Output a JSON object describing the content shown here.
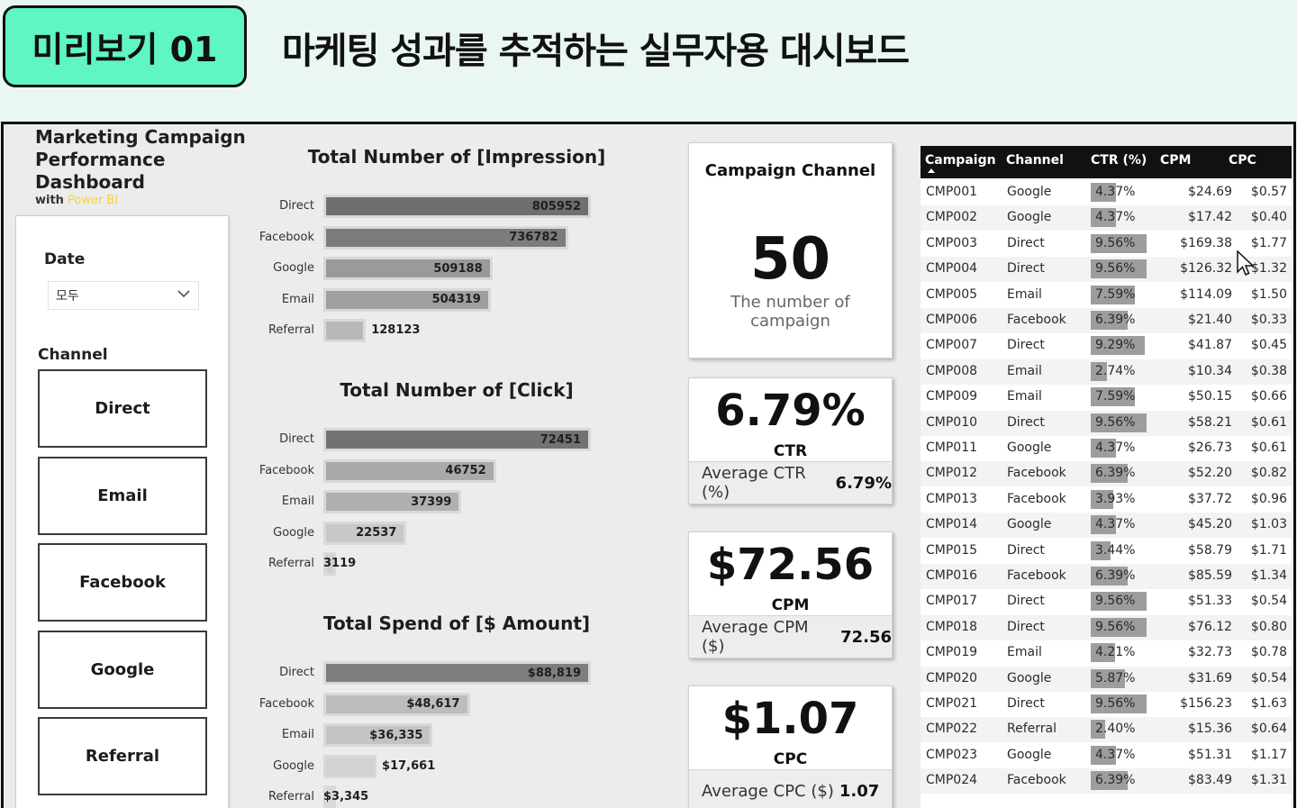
{
  "banner": {
    "badge": "미리보기 01",
    "title": "마케팅 성과를 추적하는 실무자용 대시보드"
  },
  "colors": {
    "badge_bg": "#5ff5c4",
    "powerbi_yellow": "#f6d33b",
    "table_header": "#111111"
  },
  "app": {
    "title_lines": [
      "Marketing Campaign",
      "Performance",
      "Dashboard"
    ],
    "with": "with",
    "powerbi": "Power BI"
  },
  "slicers": {
    "date_label": "Date",
    "date_value": "모두",
    "channel_label": "Channel",
    "channels": [
      "Direct",
      "Email",
      "Facebook",
      "Google",
      "Referral"
    ]
  },
  "chart_data": [
    {
      "type": "bar",
      "title": "Total Number of [Impression]",
      "categories": [
        "Direct",
        "Facebook",
        "Google",
        "Email",
        "Referral"
      ],
      "values": [
        805952,
        736782,
        509188,
        504319,
        128123
      ],
      "labels": [
        "805952",
        "736782",
        "509188",
        "504319",
        "128123"
      ]
    },
    {
      "type": "bar",
      "title": "Total Number of [Click]",
      "categories": [
        "Direct",
        "Facebook",
        "Email",
        "Google",
        "Referral"
      ],
      "values": [
        72451,
        46752,
        37399,
        22537,
        3119
      ],
      "labels": [
        "72451",
        "46752",
        "37399",
        "22537",
        "3119"
      ]
    },
    {
      "type": "bar",
      "title": "Total Spend of [$ Amount]",
      "categories": [
        "Direct",
        "Facebook",
        "Email",
        "Google",
        "Referral"
      ],
      "values": [
        88819,
        48617,
        36335,
        17661,
        3345
      ],
      "labels": [
        "$88,819",
        "$48,617",
        "$36,335",
        "$17,661",
        "$3,345"
      ]
    }
  ],
  "kpis": {
    "campaign": {
      "title": "Campaign Channel",
      "value": "50",
      "caption": "The number of campaign"
    },
    "ctr": {
      "value": "6.79%",
      "label": "CTR",
      "foot_label": "Average CTR (%)",
      "foot_value": "6.79%"
    },
    "cpm": {
      "value": "$72.56",
      "label": "CPM",
      "foot_label": "Average CPM ($)",
      "foot_value": "72.56"
    },
    "cpc": {
      "value": "$1.07",
      "label": "CPC",
      "foot_label": "Average CPC ($)",
      "foot_value": "1.07"
    }
  },
  "table": {
    "columns": [
      "Campaign",
      "Channel",
      "CTR (%)",
      "CPM",
      "CPC"
    ],
    "rows": [
      [
        "CMP001",
        "Google",
        "4.37%",
        "$24.69",
        "$0.57"
      ],
      [
        "CMP002",
        "Google",
        "4.37%",
        "$17.42",
        "$0.40"
      ],
      [
        "CMP003",
        "Direct",
        "9.56%",
        "$169.38",
        "$1.77"
      ],
      [
        "CMP004",
        "Direct",
        "9.56%",
        "$126.32",
        "$1.32"
      ],
      [
        "CMP005",
        "Email",
        "7.59%",
        "$114.09",
        "$1.50"
      ],
      [
        "CMP006",
        "Facebook",
        "6.39%",
        "$21.40",
        "$0.33"
      ],
      [
        "CMP007",
        "Direct",
        "9.29%",
        "$41.87",
        "$0.45"
      ],
      [
        "CMP008",
        "Email",
        "2.74%",
        "$10.34",
        "$0.38"
      ],
      [
        "CMP009",
        "Email",
        "7.59%",
        "$50.15",
        "$0.66"
      ],
      [
        "CMP010",
        "Direct",
        "9.56%",
        "$58.21",
        "$0.61"
      ],
      [
        "CMP011",
        "Google",
        "4.37%",
        "$26.73",
        "$0.61"
      ],
      [
        "CMP012",
        "Facebook",
        "6.39%",
        "$52.20",
        "$0.82"
      ],
      [
        "CMP013",
        "Facebook",
        "3.93%",
        "$37.72",
        "$0.96"
      ],
      [
        "CMP014",
        "Google",
        "4.37%",
        "$45.20",
        "$1.03"
      ],
      [
        "CMP015",
        "Direct",
        "3.44%",
        "$58.79",
        "$1.71"
      ],
      [
        "CMP016",
        "Facebook",
        "6.39%",
        "$85.59",
        "$1.34"
      ],
      [
        "CMP017",
        "Direct",
        "9.56%",
        "$51.33",
        "$0.54"
      ],
      [
        "CMP018",
        "Direct",
        "9.56%",
        "$76.12",
        "$0.80"
      ],
      [
        "CMP019",
        "Email",
        "4.21%",
        "$32.73",
        "$0.78"
      ],
      [
        "CMP020",
        "Google",
        "5.87%",
        "$31.69",
        "$0.54"
      ],
      [
        "CMP021",
        "Direct",
        "9.56%",
        "$156.23",
        "$1.63"
      ],
      [
        "CMP022",
        "Referral",
        "2.40%",
        "$15.36",
        "$0.64"
      ],
      [
        "CMP023",
        "Google",
        "4.37%",
        "$51.31",
        "$1.17"
      ],
      [
        "CMP024",
        "Facebook",
        "6.39%",
        "$83.49",
        "$1.31"
      ]
    ],
    "ctr_bar_max": 9.56
  }
}
